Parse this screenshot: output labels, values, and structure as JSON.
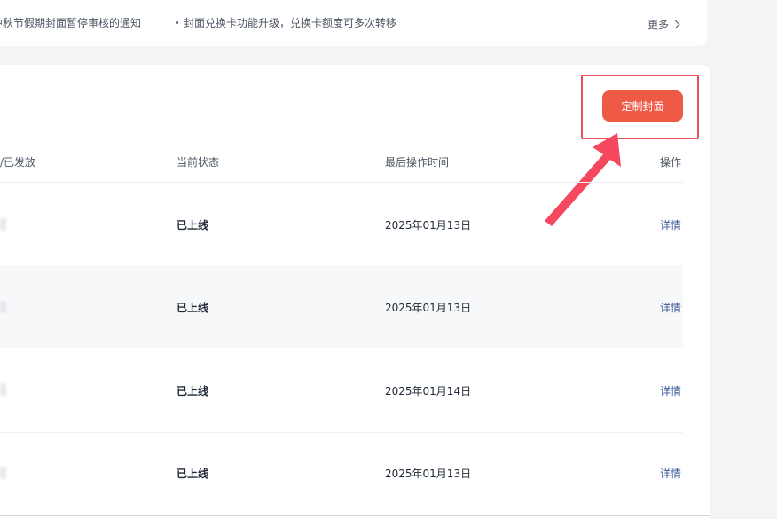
{
  "notices": {
    "item1": "中秋节假期封面暂停审核的通知",
    "item2": "封面兑换卡功能升级，兑换卡额度可多次转移",
    "more": "更多"
  },
  "toolbar": {
    "custom_cover_label": "定制封面"
  },
  "table": {
    "columns": {
      "issued": "/已发放",
      "status": "当前状态",
      "last_op_time": "最后操作时间",
      "action": "操作"
    },
    "rows": [
      {
        "status": "已上线",
        "date": "2025年01月13日",
        "action": "详情"
      },
      {
        "status": "已上线",
        "date": "2025年01月13日",
        "action": "详情"
      },
      {
        "status": "已上线",
        "date": "2025年01月14日",
        "action": "详情"
      },
      {
        "status": "已上线",
        "date": "2025年01月13日",
        "action": "详情"
      }
    ]
  },
  "colors": {
    "accent": "#ee5a45",
    "highlight": "#e8505b",
    "link": "#3b5998"
  }
}
